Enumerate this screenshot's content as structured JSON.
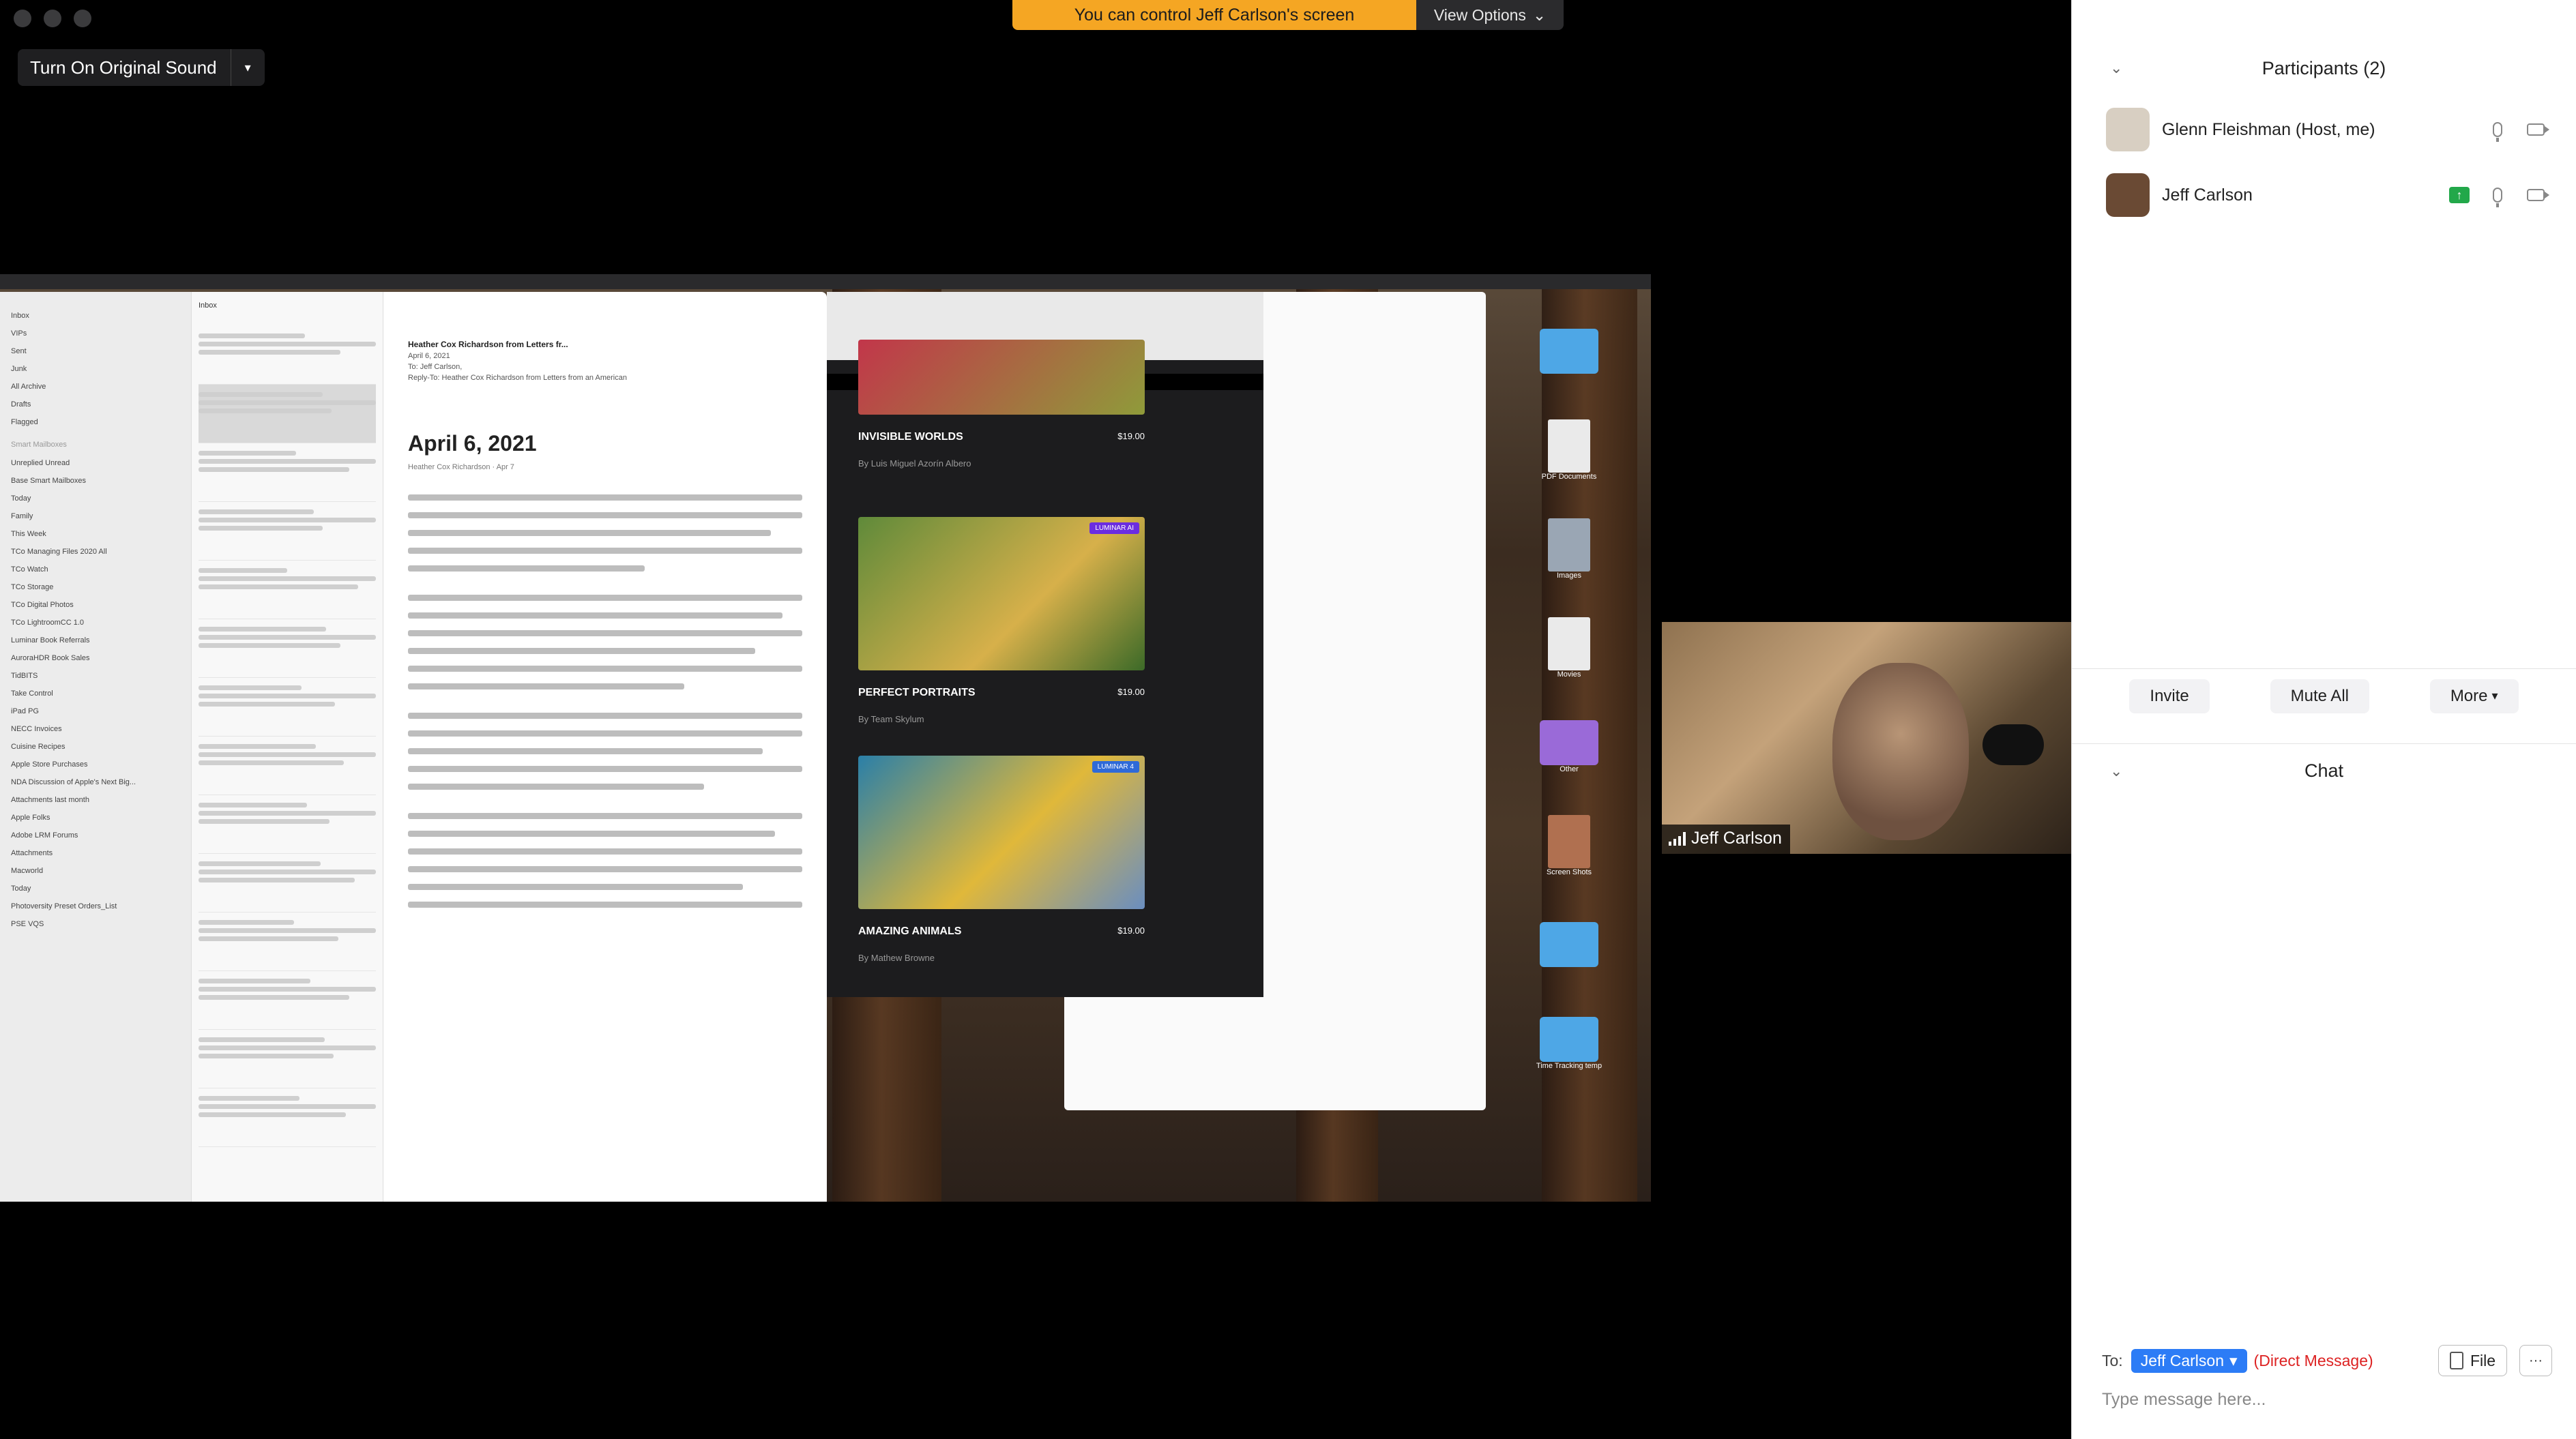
{
  "banner": {
    "message": "You can control Jeff Carlson's screen",
    "view_options_label": "View Options",
    "view_options_chevron": "⌄",
    "color": "#f5a623"
  },
  "audio": {
    "original_sound_label": "Turn On Original Sound",
    "dropdown_glyph": "▾"
  },
  "shared_screen": {
    "mail": {
      "sidebar_items": [
        "Inbox",
        "VIPs",
        "Sent",
        "Junk",
        "All Archive",
        "Drafts",
        "Flagged"
      ],
      "smart_mailboxes_header": "Smart Mailboxes",
      "smart_items": [
        "Unreplied Unread",
        "Base Smart Mailboxes",
        "Today",
        "Family",
        "This Week",
        "TCo Managing Files 2020 All",
        "TCo Watch",
        "TCo Storage",
        "TCo Digital Photos",
        "TCo LightroomCC 1.0",
        "Luminar Book Referrals",
        "AuroraHDR Book Sales",
        "TidBITS",
        "Take Control",
        "iPad PG",
        "NECC Invoices",
        "Cuisine Recipes",
        "Apple Store Purchases",
        "NDA Discussion of Apple's Next Big...",
        "Attachments last month",
        "Apple Folks",
        "Adobe LRM Forums",
        "Attachments",
        "Macworld",
        "Today",
        "Photoversity Preset Orders_List",
        "PSE VQS"
      ],
      "list_header": "Inbox",
      "from": "Heather Cox Richardson from Letters fr...",
      "date_line": "April 6, 2021",
      "to_line": "To: Jeff Carlson,",
      "reply_to": "Reply-To: Heather Cox Richardson from Letters from an American",
      "headline": "April 6, 2021",
      "byline": "Heather Cox Richardson · Apr 7"
    },
    "store": {
      "cards": [
        {
          "title": "INVISIBLE WORLDS",
          "price": "$19.00",
          "author": "By Luis Miguel Azorín Albero"
        },
        {
          "title": "PERFECT PORTRAITS",
          "price": "$19.00",
          "author": "By Team Skylum",
          "badge": "LUMINAR AI"
        },
        {
          "title": "AMAZING ANIMALS",
          "price": "$19.00",
          "author": "By Mathew Browne",
          "badge": "LUMINAR 4"
        }
      ]
    },
    "desktop_icons": [
      "",
      "PDF Documents",
      "Images",
      "Movies",
      "Other",
      "Screen Shots",
      "",
      "Time Tracking temp"
    ]
  },
  "video": {
    "participant_name": "Jeff Carlson"
  },
  "participants_panel": {
    "title": "Participants (2)",
    "collapse_glyph": "⌄",
    "participants": [
      {
        "name": "Glenn Fleishman (Host, me)",
        "avatar_color": "#d8cfc2"
      },
      {
        "name": "Jeff Carlson",
        "avatar_color": "#6a4a34",
        "sharing": true
      }
    ],
    "actions": {
      "invite": "Invite",
      "mute_all": "Mute All",
      "more": "More"
    }
  },
  "chat": {
    "title": "Chat",
    "to_label": "To:",
    "recipient": "Jeff Carlson",
    "direct_message": "(Direct Message)",
    "file_label": "File",
    "more_glyph": "···",
    "placeholder": "Type message here..."
  }
}
